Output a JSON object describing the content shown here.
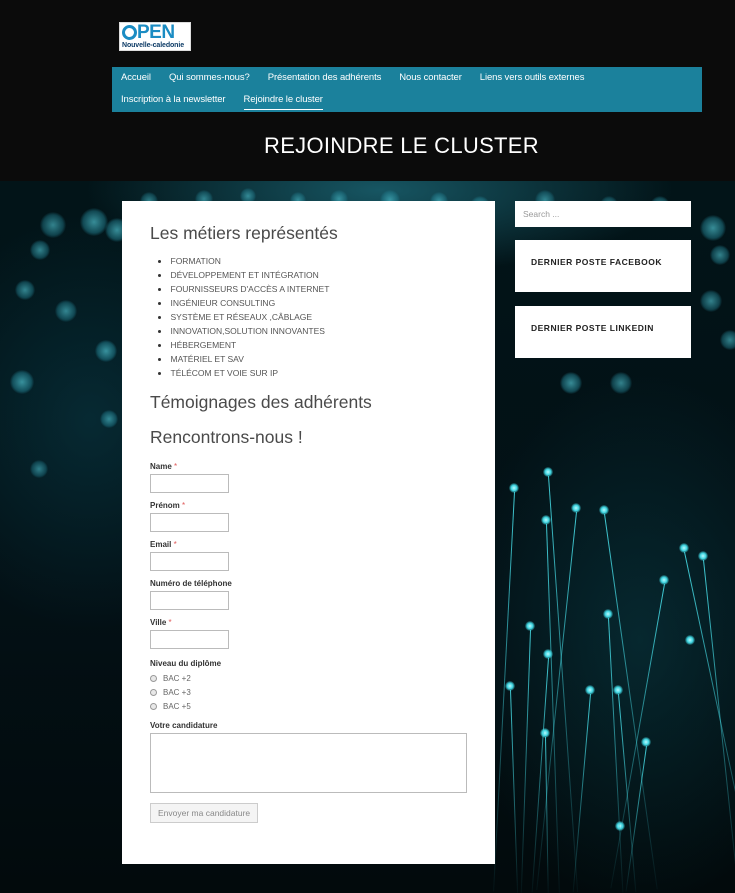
{
  "logo": {
    "top": "PEN",
    "bottom": "Nouvelle-caledonie"
  },
  "nav": {
    "row1": [
      "Accueil",
      "Qui sommes-nous?",
      "Présentation des adhérents",
      "Nous contacter",
      "Liens vers outils externes"
    ],
    "row2": [
      "Inscription à la newsletter",
      "Rejoindre le cluster"
    ]
  },
  "page_title": "REJOINDRE LE CLUSTER",
  "main": {
    "heading_metiers": "Les métiers représentés",
    "metiers": [
      "FORMATION",
      "DÉVELOPPEMENT ET INTÉGRATION",
      "FOURNISSEURS D'ACCÈS A INTERNET",
      "INGÉNIEUR CONSULTING",
      "SYSTÈME ET RÉSEAUX ,CÂBLAGE",
      "INNOVATION,SOLUTION INNOVANTES",
      "HÉBERGEMENT",
      "MATÉRIEL ET SAV",
      "TÉLÉCOM ET VOIE SUR IP"
    ],
    "heading_temoignages": "Témoignages des adhérents",
    "heading_rencontre": "Rencontrons-nous !"
  },
  "form": {
    "name_label": "Name",
    "prenom_label": "Prénom",
    "email_label": "Email",
    "phone_label": "Numéro de téléphone",
    "ville_label": "Ville",
    "required_mark": "*",
    "diplome_label": "Niveau du diplôme",
    "diplome_options": [
      "BAC +2",
      "BAC +3",
      "BAC +5"
    ],
    "candidature_label": "Votre candidature",
    "submit_label": "Envoyer ma candidature"
  },
  "sidebar": {
    "search_placeholder": "Search ...",
    "widget_facebook": "DERNIER POSTE FACEBOOK",
    "widget_linkedin": "DERNIER POSTE LINKEDIN"
  },
  "colors": {
    "nav_bg": "#1b819c",
    "accent": "#1b8cc3",
    "required": "#e05a5a"
  }
}
